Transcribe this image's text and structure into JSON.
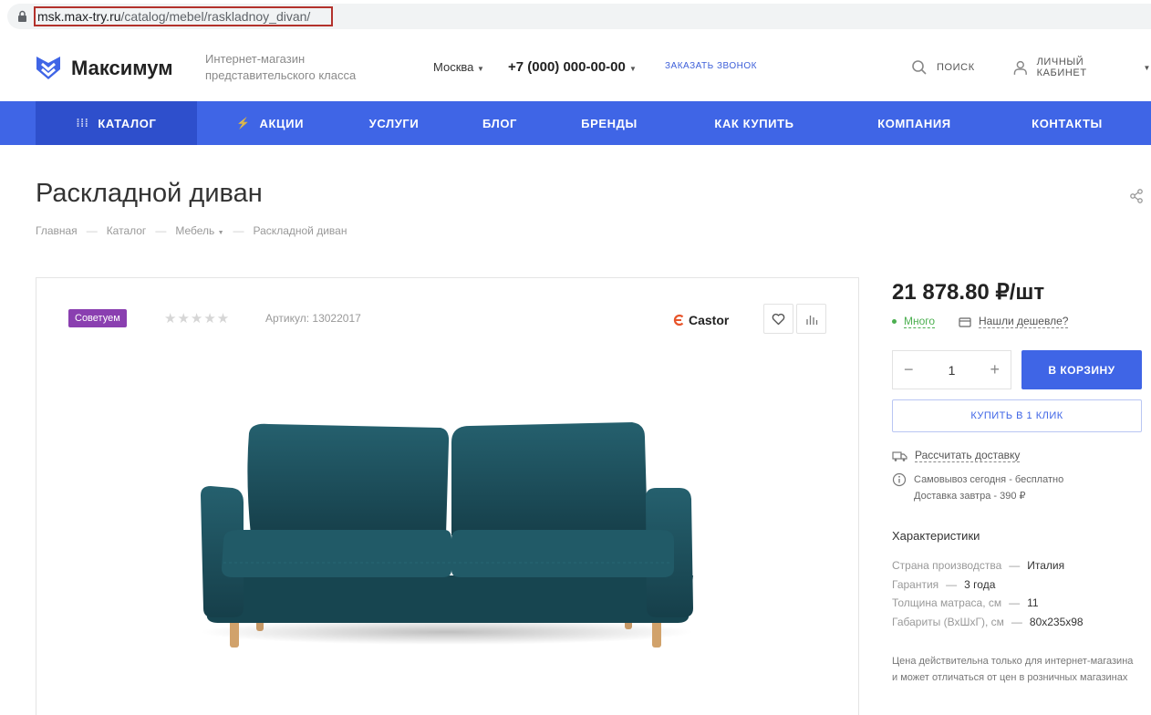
{
  "browser": {
    "url_host": "msk.max-try.ru",
    "url_path": "/catalog/mebel/raskladnoy_divan/"
  },
  "header": {
    "logo_text": "Максимум",
    "tagline_line1": "Интернет-магазин",
    "tagline_line2": "представительского класса",
    "city": "Москва",
    "phone": "+7 (000) 000-00-00",
    "callback": "ЗАКАЗАТЬ ЗВОНОК",
    "search_label": "ПОИСК",
    "account_label": "ЛИЧНЫЙ КАБИНЕТ"
  },
  "nav": {
    "items": [
      {
        "label": "КАТАЛОГ"
      },
      {
        "label": "АКЦИИ"
      },
      {
        "label": "УСЛУГИ"
      },
      {
        "label": "БЛОГ"
      },
      {
        "label": "БРЕНДЫ"
      },
      {
        "label": "КАК КУПИТЬ"
      },
      {
        "label": "КОМПАНИЯ"
      },
      {
        "label": "КОНТАКТЫ"
      }
    ]
  },
  "page": {
    "title": "Раскладной диван",
    "breadcrumb": [
      "Главная",
      "Каталог",
      "Мебель",
      "Раскладной диван"
    ]
  },
  "product": {
    "badge": "Советуем",
    "stars": "★★★★★",
    "rating": 0,
    "article": "Артикул: 13022017",
    "brand": "Castor",
    "price": "21 878.80 ₽/шт",
    "stock": "Много",
    "cheaper": "Нашли дешевле?",
    "quantity": "1",
    "cart_button": "В КОРЗИНУ",
    "one_click": "КУПИТЬ В 1 КЛИК",
    "delivery_calc": "Рассчитать доставку",
    "pickup": "Самовывоз сегодня - бесплатно",
    "delivery_tomorrow": "Доставка завтра - 390 ₽",
    "characteristics_title": "Характеристики",
    "characteristics": [
      {
        "key": "Страна производства",
        "value": "Италия"
      },
      {
        "key": "Гарантия",
        "value": "3 года"
      },
      {
        "key": "Толщина матраса, см",
        "value": "11"
      },
      {
        "key": "Габариты (ВхШхГ), см",
        "value": "80х235х98"
      }
    ],
    "note": "Цена действительна только для интернет-магазина и может отличаться от цен в розничных магазинах"
  },
  "colors": {
    "accent": "#3f65e6",
    "nav_active": "#2e4fcc",
    "badge": "#8a3fb0",
    "stock": "#4caf50",
    "sofa": "#1f5664"
  }
}
